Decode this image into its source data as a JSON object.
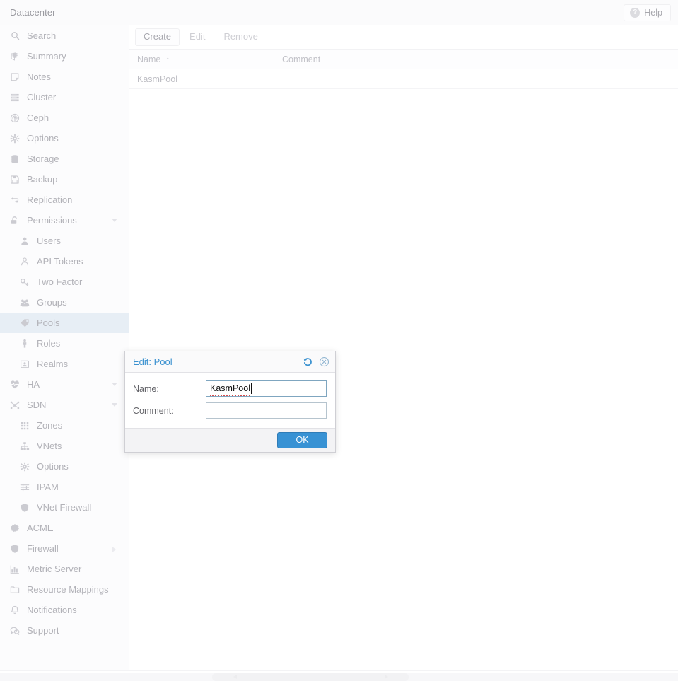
{
  "topbar": {
    "title": "Datacenter",
    "help_label": "Help",
    "help_icon": "question-circle-icon"
  },
  "sidebar": {
    "search": {
      "label": "Search",
      "icon": "search-icon"
    },
    "items": [
      {
        "label": "Summary",
        "icon": "book-icon",
        "level": 0,
        "selected": false,
        "expander": ""
      },
      {
        "label": "Notes",
        "icon": "note-icon",
        "level": 0,
        "selected": false,
        "expander": ""
      },
      {
        "label": "Cluster",
        "icon": "server-stack-icon",
        "level": 0,
        "selected": false,
        "expander": ""
      },
      {
        "label": "Ceph",
        "icon": "ceph-icon",
        "level": 0,
        "selected": false,
        "expander": ""
      },
      {
        "label": "Options",
        "icon": "gear-icon",
        "level": 0,
        "selected": false,
        "expander": ""
      },
      {
        "label": "Storage",
        "icon": "database-icon",
        "level": 0,
        "selected": false,
        "expander": ""
      },
      {
        "label": "Backup",
        "icon": "floppy-disk-icon",
        "level": 0,
        "selected": false,
        "expander": ""
      },
      {
        "label": "Replication",
        "icon": "refresh-arrows-icon",
        "level": 0,
        "selected": false,
        "expander": ""
      },
      {
        "label": "Permissions",
        "icon": "unlock-icon",
        "level": 0,
        "selected": false,
        "expander": "down"
      },
      {
        "label": "Users",
        "icon": "user-icon",
        "level": 1,
        "selected": false,
        "expander": ""
      },
      {
        "label": "API Tokens",
        "icon": "user-outline-icon",
        "level": 1,
        "selected": false,
        "expander": ""
      },
      {
        "label": "Two Factor",
        "icon": "key-icon",
        "level": 1,
        "selected": false,
        "expander": ""
      },
      {
        "label": "Groups",
        "icon": "users-group-icon",
        "level": 1,
        "selected": false,
        "expander": ""
      },
      {
        "label": "Pools",
        "icon": "tag-icon",
        "level": 1,
        "selected": true,
        "expander": ""
      },
      {
        "label": "Roles",
        "icon": "person-icon",
        "level": 1,
        "selected": false,
        "expander": ""
      },
      {
        "label": "Realms",
        "icon": "id-card-icon",
        "level": 1,
        "selected": false,
        "expander": ""
      },
      {
        "label": "HA",
        "icon": "heartbeat-icon",
        "level": 0,
        "selected": false,
        "expander": "down"
      },
      {
        "label": "SDN",
        "icon": "network-nodes-icon",
        "level": 0,
        "selected": false,
        "expander": "down"
      },
      {
        "label": "Zones",
        "icon": "grid-dots-icon",
        "level": 1,
        "selected": false,
        "expander": ""
      },
      {
        "label": "VNets",
        "icon": "sitemap-icon",
        "level": 1,
        "selected": false,
        "expander": ""
      },
      {
        "label": "Options",
        "icon": "gear-icon",
        "level": 1,
        "selected": false,
        "expander": ""
      },
      {
        "label": "IPAM",
        "icon": "sliders-icon",
        "level": 1,
        "selected": false,
        "expander": ""
      },
      {
        "label": "VNet Firewall",
        "icon": "shield-icon",
        "level": 1,
        "selected": false,
        "expander": ""
      },
      {
        "label": "ACME",
        "icon": "certificate-icon",
        "level": 0,
        "selected": false,
        "expander": ""
      },
      {
        "label": "Firewall",
        "icon": "shield-icon",
        "level": 0,
        "selected": false,
        "expander": "right"
      },
      {
        "label": "Metric Server",
        "icon": "bar-chart-icon",
        "level": 0,
        "selected": false,
        "expander": ""
      },
      {
        "label": "Resource Mappings",
        "icon": "folder-icon",
        "level": 0,
        "selected": false,
        "expander": ""
      },
      {
        "label": "Notifications",
        "icon": "bell-icon",
        "level": 0,
        "selected": false,
        "expander": ""
      },
      {
        "label": "Support",
        "icon": "comments-icon",
        "level": 0,
        "selected": false,
        "expander": ""
      }
    ]
  },
  "content": {
    "toolbar": {
      "create_label": "Create",
      "edit_label": "Edit",
      "remove_label": "Remove"
    },
    "grid": {
      "columns": [
        {
          "label": "Name",
          "sort": "ascending",
          "sort_glyph": "↑"
        },
        {
          "label": "Comment",
          "sort": "",
          "sort_glyph": ""
        }
      ],
      "rows": [
        {
          "name": "KasmPool",
          "comment": ""
        }
      ]
    }
  },
  "modal": {
    "title": "Edit: Pool",
    "reset_icon": "reset-circular-arrow-icon",
    "close_icon": "close-circle-icon",
    "fields": [
      {
        "label": "Name:",
        "value": "KasmPool",
        "placeholder": "",
        "focused": true,
        "misspelled": true
      },
      {
        "label": "Comment:",
        "value": "",
        "placeholder": "",
        "focused": false,
        "misspelled": false
      }
    ],
    "ok_label": "OK"
  },
  "colors": {
    "accent": "#3892d4",
    "selected_row": "#e7eef5",
    "title_blue": "#3b92d0",
    "spellcheck_red": "#d94a4a"
  }
}
